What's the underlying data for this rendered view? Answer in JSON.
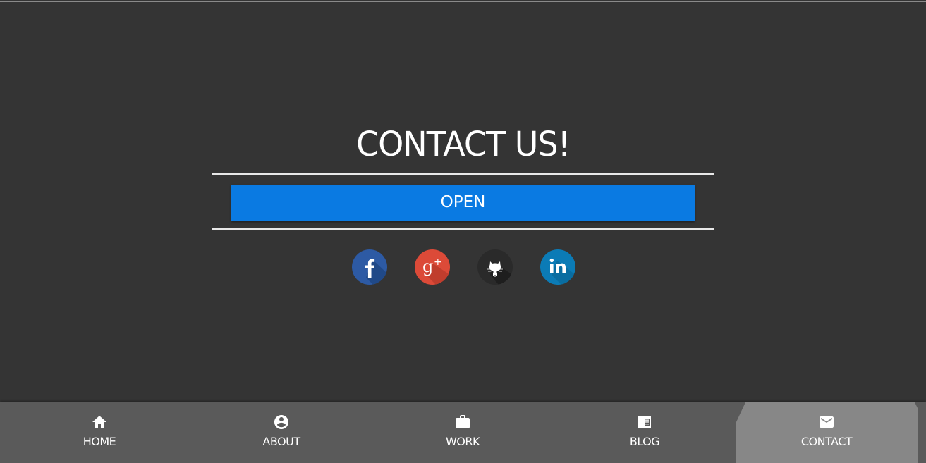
{
  "contact": {
    "title": "CONTACT US!",
    "open_label": "OPEN"
  },
  "social": [
    {
      "name": "facebook",
      "color": "#2d5aa4"
    },
    {
      "name": "google-plus",
      "color": "#dc4a38"
    },
    {
      "name": "github",
      "color": "#2a2a2a"
    },
    {
      "name": "linkedin",
      "color": "#0b7bb6"
    }
  ],
  "nav": {
    "items": [
      {
        "label": "HOME",
        "icon": "home-icon"
      },
      {
        "label": "ABOUT",
        "icon": "account-circle-icon"
      },
      {
        "label": "WORK",
        "icon": "briefcase-icon"
      },
      {
        "label": "BLOG",
        "icon": "article-icon"
      },
      {
        "label": "CONTACT",
        "icon": "mail-icon",
        "active": true
      }
    ]
  },
  "colors": {
    "background": "#343434",
    "accent": "#0a7ae2",
    "navbar": "#5a5a5a",
    "nav_active": "#878787"
  }
}
